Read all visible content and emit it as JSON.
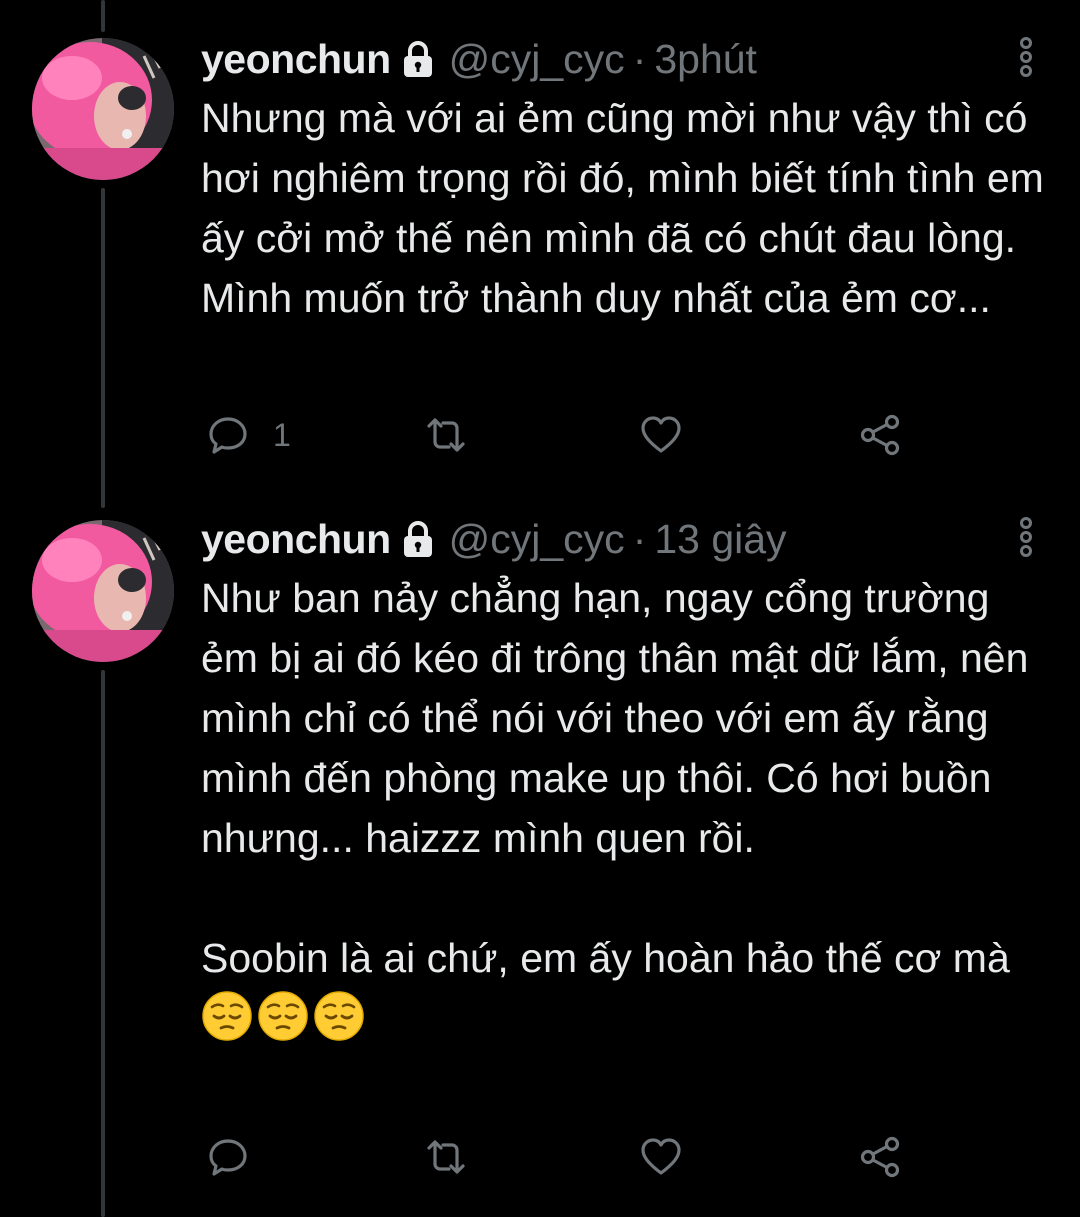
{
  "colors": {
    "background": "#000000",
    "text": "#e7e9ea",
    "secondary": "#71767b",
    "thread_line": "#333639",
    "avatar_hair": "#f25aa0"
  },
  "tweets": [
    {
      "display_name": "yeonchun",
      "protected_icon": "lock-icon",
      "handle": "@cyj_cyc",
      "separator": "·",
      "time": "3phút",
      "text": "Nhưng mà với ai ẻm cũng mời như vậy thì có hơi nghiêm trọng rồi đó, mình biết tính tình em ấy cởi mở thế nên mình đã có chút đau lòng. Mình muốn trở thành duy nhất của ẻm cơ...",
      "actions": {
        "reply_count": "1",
        "retweet_count": "",
        "like_count": ""
      }
    },
    {
      "display_name": "yeonchun",
      "protected_icon": "lock-icon",
      "handle": "@cyj_cyc",
      "separator": "·",
      "time": "13 giây",
      "text": "Như ban nảy chẳng hạn, ngay cổng trường ẻm bị ai đó kéo đi trông thân mật dữ lắm, nên mình chỉ có thể nói với theo với em ấy rằng mình đến phòng make up thôi. Có hơi buồn nhưng... haizzz mình quen rồi.\n\nSoobin là ai chứ, em ấy hoàn hảo thế cơ mà",
      "emoji": [
        "pensive-face",
        "pensive-face",
        "pensive-face"
      ],
      "actions": {
        "reply_count": "",
        "retweet_count": "",
        "like_count": ""
      }
    }
  ]
}
